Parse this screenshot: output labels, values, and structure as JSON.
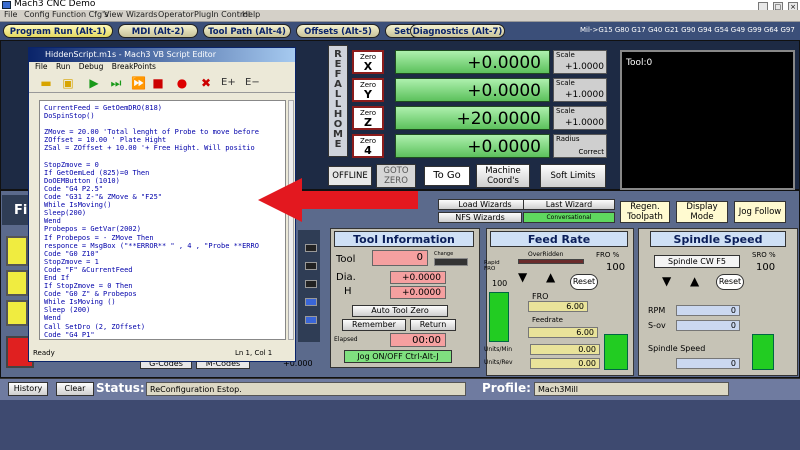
{
  "window": {
    "title": "Mach3 CNC  Demo",
    "menus": [
      "File",
      "Config",
      "Function Cfg's",
      "View",
      "Wizards",
      "Operator",
      "PlugIn Control",
      "Help"
    ],
    "controls": [
      "_",
      "□",
      "×"
    ]
  },
  "tabs": [
    {
      "label": "Program Run (Alt-1)"
    },
    {
      "label": "MDI (Alt-2)"
    },
    {
      "label": "Tool Path (Alt-4)"
    },
    {
      "label": "Offsets (Alt-5)"
    },
    {
      "label": "Settings (Alt-6)"
    },
    {
      "label": "Diagnostics (Alt-7)"
    }
  ],
  "mcodes": "Mil->G15  G80 G17 G40 G21 G90 G94 G54 G49 G99 G64 G97",
  "dro": {
    "ref_all_home": "REF ALL HOME",
    "axes": [
      {
        "zero_label": "Zero",
        "axis": "X",
        "value": "+0.0000",
        "scale_label": "Scale",
        "scale": "+1.0000"
      },
      {
        "zero_label": "Zero",
        "axis": "Y",
        "value": "+0.0000",
        "scale_label": "Scale",
        "scale": "+1.0000"
      },
      {
        "zero_label": "Zero",
        "axis": "Z",
        "value": "+20.0000",
        "scale_label": "Scale",
        "scale": "+1.0000"
      },
      {
        "zero_label": "Zero",
        "axis": "4",
        "value": "+0.0000",
        "scale_label": "Radius",
        "scale": "Correct"
      }
    ],
    "offline": "OFFLINE",
    "goto_zero": "GOTO ZERO",
    "to_go": "To Go",
    "machine_coords": "Machine Coord's",
    "soft_limits": "Soft Limits"
  },
  "tool_display": {
    "label": "Tool:0"
  },
  "wizards": {
    "load": "Load Wizards",
    "last": "Last Wizard",
    "nfs": "NFS Wizards",
    "conversational": "Conversational"
  },
  "toolpath_buttons": {
    "regen": "Regen. Toolpath",
    "display_mode": "Display Mode",
    "jog_follow": "Jog Follow"
  },
  "editor": {
    "title": "HiddenScript.m1s - Mach3 VB Script Editor",
    "menus": [
      "File",
      "Run",
      "Debug",
      "BreakPoints"
    ],
    "code": "CurrentFeed = GetOemDRO(818)\nDoSpinStop()\n\nZMove = 20.00 'Total lenght of Probe to move before\nZOffset = 10.00 ' Plate Hight\nZSal = ZOffset + 10.00 '+ Free Hight. Will positio\n\nStopZmove = 0\nIf GetOemLed (825)=0 Then\nDoOEMButton (1010)\nCode \"G4 P2.5\"\nCode \"G31 Z-\"& ZMove & \"F25\"\nWhile IsMoving()\nSleep(200)\nWend\nProbepos = GetVar(2002)\nIf Probepos = - ZMove Then\nresponce = MsgBox (\"**ERROR** \" , 4 , \"Probe **ERRO\nCode \"G0 Z10\"\nStopZmove = 1\nCode \"F\" &CurrentFeed\nEnd If\nIf StopZmove = 0 Then\nCode \"G0 Z\" & Probepos\nWhile IsMoving ()\nSleep (200)\nWend\nCall SetDro (2, ZOffset)\nCode \"G4 P1\"\nCode \"G0 Z\" & ZSal",
    "status_left": "Ready",
    "status_right": "Ln 1, Col 1"
  },
  "tool_info": {
    "header": "Tool Information",
    "tool_label": "Tool",
    "tool_value": "0",
    "change_label": "Change",
    "dia_label": "Dia.",
    "dia_value": "+0.0000",
    "h_label": "H",
    "h_value": "+0.0000",
    "auto_zero": "Auto Tool Zero",
    "remember": "Remember",
    "return": "Return",
    "elapsed_label": "Elapsed",
    "elapsed_value": "00:00",
    "jog": "Jog ON/OFF Ctrl-Alt-J"
  },
  "feed_rate": {
    "header": "Feed Rate",
    "overridden": "OverRidden",
    "fro_label": "FRO %",
    "fro_percent": "100",
    "rapid_label": "Rapid FRO",
    "rapid_value": "100",
    "reset": "Reset",
    "fro": "FRO",
    "fro_value": "6.00",
    "feedrate_label": "Feedrate",
    "feedrate_value": "6.00",
    "units_min_label": "Units/Min",
    "units_min_value": "0.00",
    "units_rev_label": "Units/Rev",
    "units_rev_value": "0.00"
  },
  "spindle": {
    "header": "Spindle Speed",
    "cw": "Spindle CW F5",
    "sro_label": "SRO %",
    "sro_value": "100",
    "reset": "Reset",
    "rpm_label": "RPM",
    "rpm_value": "0",
    "sov_label": "S-ov",
    "sov_value": "0",
    "speed_label": "Spindle Speed",
    "speed_value": "0"
  },
  "lower_left": {
    "file_label": "Fil",
    "gcodes": "G-Codes",
    "mcodes": "M-Codes",
    "value": "+0.000"
  },
  "bottom": {
    "history": "History",
    "clear": "Clear",
    "status_label": "Status:",
    "status_value": "ReConfiguration Estop.",
    "profile_label": "Profile:",
    "profile_value": "Mach3Mill"
  }
}
